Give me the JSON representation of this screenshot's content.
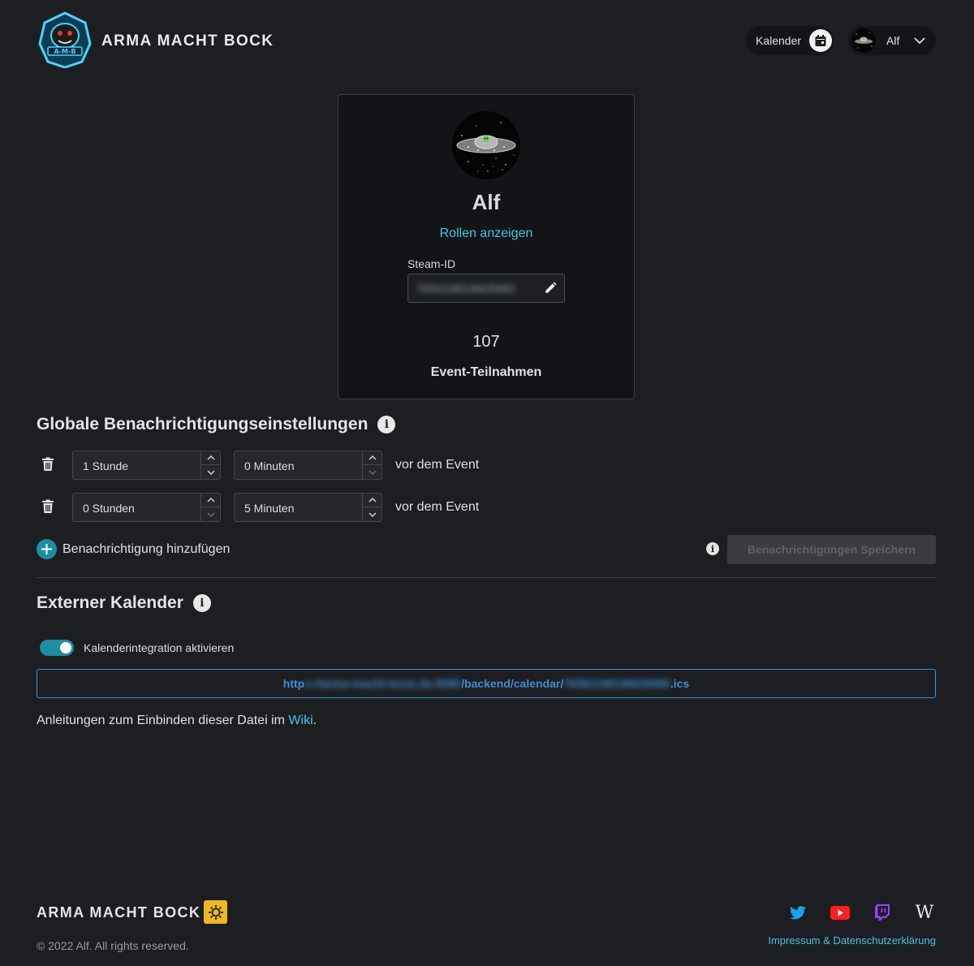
{
  "header": {
    "brand": "ARMA MACHT BOCK",
    "calendar_label": "Kalender",
    "user_name": "Alf"
  },
  "profile": {
    "name": "Alf",
    "roles_link": "Rollen anzeigen",
    "steam_label": "Steam-ID",
    "steam_value": "76561198136635682",
    "event_count": "107",
    "event_label": "Event-Teilnahmen"
  },
  "notifications": {
    "title": "Globale Benachrichtigungseinstellungen",
    "rows": [
      {
        "hours": "1 Stunde",
        "minutes": "0 Minuten",
        "suffix": "vor dem Event"
      },
      {
        "hours": "0 Stunden",
        "minutes": "5 Minuten",
        "suffix": "vor dem Event"
      }
    ],
    "add_label": "Benachrichtigung hinzufügen",
    "save_label": "Benachrichtigungen Speichern"
  },
  "external_calendar": {
    "title": "Externer Kalender",
    "toggle_label": "Kalenderintegration aktivieren",
    "toggle_on": true,
    "url_prefix": "http",
    "url_host": "s://arma-macht-bock.de:8080",
    "url_path": "/backend/calendar/",
    "url_id": "76561198136635682",
    "url_suffix": ".ics",
    "wiki_text": "Anleitungen zum Einbinden dieser Datei im ",
    "wiki_link": "Wiki",
    "wiki_end": "."
  },
  "footer": {
    "brand": "ARMA MACHT BOCK",
    "copyright": "© 2022 Alf. All rights reserved.",
    "imprint": "Impressum & Datenschutzerklärung",
    "social": [
      "twitter-icon",
      "youtube-icon",
      "twitch-icon",
      "wikipedia-icon"
    ]
  },
  "colors": {
    "background": "#1d1e22",
    "accent": "#3fc7e0",
    "teal": "#1a8fa0",
    "link_blue": "#3d8fd6"
  }
}
